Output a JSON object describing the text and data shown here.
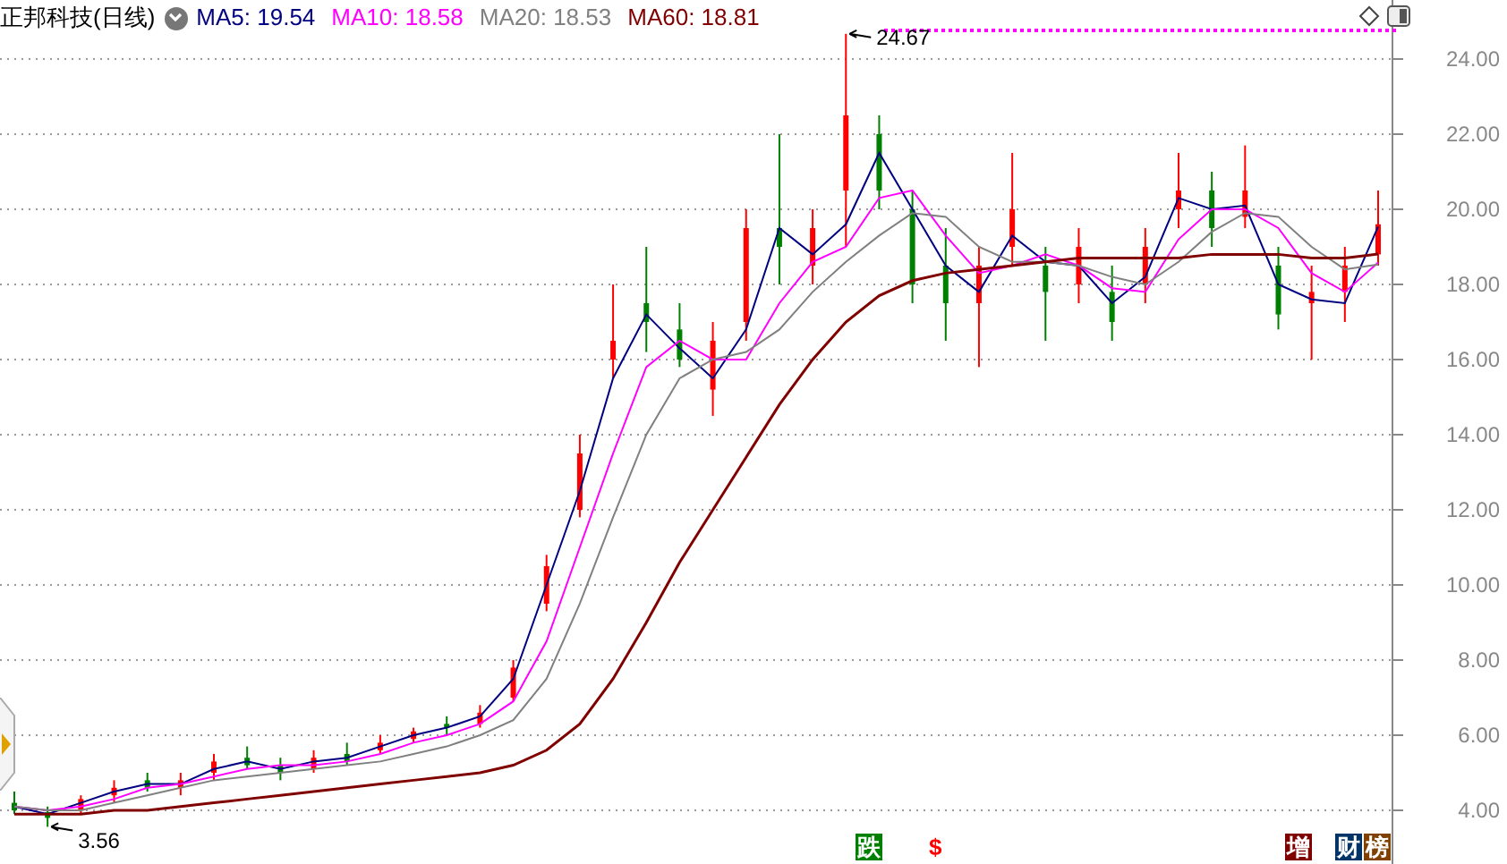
{
  "header": {
    "title": "正邦科技(日线)",
    "indicators": [
      {
        "text": "MA5: 19.54",
        "color": "#000080"
      },
      {
        "text": "MA10: 18.58",
        "color": "#ff00ff"
      },
      {
        "text": "MA20: 18.53",
        "color": "#808080"
      },
      {
        "text": "MA60: 18.81",
        "color": "#800000"
      }
    ]
  },
  "chart_data": {
    "type": "candlestick",
    "grid": true,
    "ylim": [
      2.571,
      25.571
    ],
    "yticks": [
      {
        "value": 4,
        "label": "4.00"
      },
      {
        "value": 6,
        "label": "6.00"
      },
      {
        "value": 8,
        "label": "8.00"
      },
      {
        "value": 10,
        "label": "10.00"
      },
      {
        "value": 12,
        "label": "12.00"
      },
      {
        "value": 14,
        "label": "14.00"
      },
      {
        "value": 16,
        "label": "16.00"
      },
      {
        "value": 18,
        "label": "18.00"
      },
      {
        "value": 20,
        "label": "20.00"
      },
      {
        "value": 22,
        "label": "22.00"
      },
      {
        "value": 24,
        "label": "24.00"
      }
    ],
    "ohlc": [
      [
        4.2,
        4.5,
        3.9,
        4.0
      ],
      [
        3.95,
        4.1,
        3.56,
        3.8
      ],
      [
        4.0,
        4.4,
        3.9,
        4.3
      ],
      [
        4.4,
        4.8,
        4.2,
        4.6
      ],
      [
        4.8,
        5.0,
        4.5,
        4.6
      ],
      [
        4.6,
        5.0,
        4.4,
        4.8
      ],
      [
        5.0,
        5.5,
        4.8,
        5.3
      ],
      [
        5.4,
        5.7,
        5.1,
        5.2
      ],
      [
        5.2,
        5.4,
        4.8,
        5.0
      ],
      [
        5.1,
        5.6,
        5.0,
        5.4
      ],
      [
        5.5,
        5.8,
        5.2,
        5.3
      ],
      [
        5.6,
        6.0,
        5.5,
        5.8
      ],
      [
        5.9,
        6.2,
        5.8,
        6.1
      ],
      [
        6.3,
        6.5,
        6.0,
        6.2
      ],
      [
        6.3,
        6.8,
        6.2,
        6.6
      ],
      [
        7.0,
        8.0,
        6.9,
        7.8
      ],
      [
        9.5,
        10.8,
        9.3,
        10.5
      ],
      [
        12.0,
        14.0,
        11.8,
        13.5
      ],
      [
        16.0,
        18.0,
        15.5,
        16.5
      ],
      [
        17.5,
        19.0,
        16.2,
        17.0
      ],
      [
        16.8,
        17.5,
        15.8,
        16.0
      ],
      [
        15.2,
        17.0,
        14.5,
        16.5
      ],
      [
        17.0,
        20.0,
        16.5,
        19.5
      ],
      [
        19.5,
        22.0,
        18.0,
        19.0
      ],
      [
        18.5,
        20.0,
        18.0,
        19.5
      ],
      [
        20.5,
        24.67,
        19.0,
        22.5
      ],
      [
        22.0,
        22.5,
        20.0,
        20.5
      ],
      [
        20.0,
        20.5,
        17.5,
        18.0
      ],
      [
        18.5,
        19.5,
        16.5,
        17.5
      ],
      [
        17.5,
        19.0,
        15.8,
        18.5
      ],
      [
        19.0,
        21.5,
        18.5,
        20.0
      ],
      [
        18.5,
        19.0,
        16.5,
        17.8
      ],
      [
        18.0,
        19.5,
        17.5,
        19.0
      ],
      [
        17.8,
        18.5,
        16.5,
        17.0
      ],
      [
        18.0,
        19.5,
        17.5,
        19.0
      ],
      [
        20.0,
        21.5,
        19.5,
        20.5
      ],
      [
        20.5,
        21.0,
        19.0,
        19.5
      ],
      [
        19.8,
        21.7,
        19.5,
        20.5
      ],
      [
        18.5,
        19.0,
        16.8,
        17.2
      ],
      [
        17.5,
        18.5,
        16.0,
        17.8
      ],
      [
        17.8,
        19.0,
        17.0,
        18.5
      ],
      [
        18.8,
        20.5,
        18.5,
        19.6
      ]
    ],
    "annotations": [
      "24.67",
      "3.56"
    ]
  },
  "moving_averages": {
    "chart_data": {
      "type": "line",
      "ylim": [
        2.571,
        25.571
      ],
      "series": [
        {
          "color": "#000080",
          "values": [
            4.1,
            3.9,
            4.2,
            4.5,
            4.7,
            4.7,
            5.1,
            5.3,
            5.1,
            5.3,
            5.4,
            5.7,
            6.0,
            6.2,
            6.5,
            7.5,
            10.0,
            12.5,
            15.5,
            17.2,
            16.3,
            15.5,
            16.8,
            19.5,
            18.8,
            19.6,
            21.5,
            20.0,
            18.5,
            17.8,
            19.3,
            18.6,
            18.5,
            17.5,
            18.2,
            20.3,
            20.0,
            20.1,
            18.0,
            17.6,
            17.5,
            19.54
          ]
        },
        {
          "color": "#ff00ff",
          "values": [
            4.1,
            4.0,
            4.1,
            4.3,
            4.6,
            4.7,
            4.9,
            5.1,
            5.2,
            5.2,
            5.3,
            5.5,
            5.8,
            6.0,
            6.3,
            6.9,
            8.5,
            11.0,
            13.5,
            15.8,
            16.5,
            16.0,
            16.0,
            17.5,
            18.6,
            19.0,
            20.3,
            20.5,
            19.3,
            18.3,
            18.5,
            18.8,
            18.5,
            17.9,
            17.8,
            19.2,
            20.0,
            20.0,
            19.5,
            18.3,
            17.8,
            18.58
          ]
        },
        {
          "color": "#808080",
          "values": [
            4.1,
            4.0,
            4.0,
            4.2,
            4.4,
            4.6,
            4.8,
            4.9,
            5.0,
            5.1,
            5.2,
            5.3,
            5.5,
            5.7,
            6.0,
            6.4,
            7.5,
            9.5,
            11.8,
            14.0,
            15.5,
            16.0,
            16.2,
            16.8,
            17.8,
            18.6,
            19.3,
            19.9,
            19.8,
            19.0,
            18.6,
            18.6,
            18.5,
            18.2,
            18.0,
            18.6,
            19.4,
            19.9,
            19.8,
            19.0,
            18.4,
            18.53
          ]
        },
        {
          "color": "#800000",
          "values": [
            3.9,
            3.9,
            3.9,
            4.0,
            4.0,
            4.1,
            4.2,
            4.3,
            4.4,
            4.5,
            4.6,
            4.7,
            4.8,
            4.9,
            5.0,
            5.2,
            5.6,
            6.3,
            7.5,
            9.0,
            10.6,
            12.0,
            13.4,
            14.8,
            16.0,
            17.0,
            17.7,
            18.1,
            18.3,
            18.4,
            18.5,
            18.6,
            18.7,
            18.7,
            18.7,
            18.7,
            18.8,
            18.8,
            18.8,
            18.7,
            18.7,
            18.81
          ]
        }
      ]
    }
  },
  "markers": [
    {
      "text": "跌",
      "kind": "boxed",
      "color": "#008000"
    },
    {
      "text": "$",
      "kind": "plain",
      "color": "#ff0000"
    },
    {
      "text": "增",
      "kind": "boxed",
      "color": "#800000"
    },
    {
      "text": "财",
      "kind": "boxed",
      "color": "#003366"
    },
    {
      "text": "榜",
      "kind": "boxed",
      "color": "#804000"
    }
  ]
}
